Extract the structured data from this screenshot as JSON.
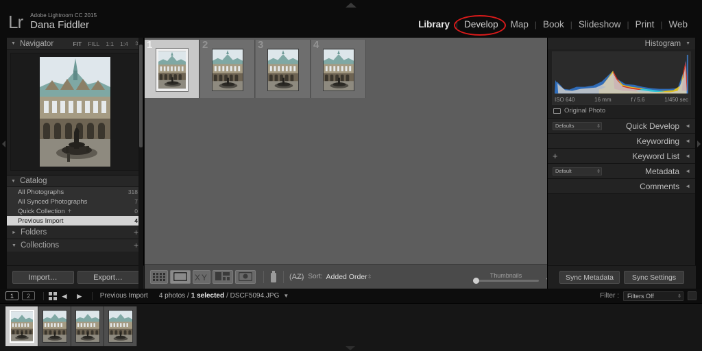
{
  "app": {
    "logo": "Lr",
    "product": "Adobe Lightroom CC 2015",
    "user": "Dana Fiddler"
  },
  "modules": {
    "items": [
      {
        "label": "Library",
        "active": true
      },
      {
        "label": "Develop",
        "active": false,
        "highlighted": true
      },
      {
        "label": "Map",
        "active": false
      },
      {
        "label": "Book",
        "active": false
      },
      {
        "label": "Slideshow",
        "active": false
      },
      {
        "label": "Print",
        "active": false
      },
      {
        "label": "Web",
        "active": false
      }
    ],
    "separator": "|",
    "highlight_color": "#d81a1a"
  },
  "left_panel": {
    "navigator": {
      "title": "Navigator",
      "twisty": "▼",
      "zoom_levels": [
        "FIT",
        "FILL",
        "1:1",
        "1:4"
      ],
      "active_zoom": "FIT"
    },
    "catalog": {
      "title": "Catalog",
      "twisty": "▼",
      "rows": [
        {
          "label": "All Photographs",
          "count": "318",
          "selected": false
        },
        {
          "label": "All Synced Photographs",
          "count": "7",
          "selected": false
        },
        {
          "label": "Quick Collection",
          "count": "0",
          "selected": false,
          "plus": "+"
        },
        {
          "label": "Previous Import",
          "count": "4",
          "selected": true
        }
      ]
    },
    "folders": {
      "title": "Folders",
      "twisty": "►",
      "add": "+"
    },
    "collections": {
      "title": "Collections",
      "twisty": "▼",
      "add": "+"
    },
    "import_button": "Import…",
    "export_button": "Export…"
  },
  "grid": {
    "cells": [
      {
        "index": "1",
        "selected": true
      },
      {
        "index": "2",
        "selected": false
      },
      {
        "index": "3",
        "selected": false
      },
      {
        "index": "4",
        "selected": false
      }
    ]
  },
  "toolbar": {
    "view_buttons": [
      {
        "name": "grid-view",
        "active": false
      },
      {
        "name": "loupe-view",
        "active": true
      },
      {
        "name": "compare-view",
        "active": false
      },
      {
        "name": "survey-view",
        "active": false
      },
      {
        "name": "people-view",
        "active": false
      }
    ],
    "painter_icon": "spray-can-icon",
    "sort_icon": "A/Z",
    "sort_label": "Sort:",
    "sort_value": "Added Order",
    "thumbnails_label": "Thumbnails",
    "thumbnails_value": 6
  },
  "right_panel": {
    "histogram": {
      "title": "Histogram",
      "caret": "▼",
      "iso": "ISO 640",
      "focal": "16 mm",
      "aperture": "f / 5.6",
      "shutter": "1/450 sec",
      "original_photo": "Original Photo"
    },
    "sections": [
      {
        "label": "Quick Develop",
        "caret": "◄",
        "select": "Defaults",
        "plus": null
      },
      {
        "label": "Keywording",
        "caret": "◄",
        "select": null,
        "plus": null
      },
      {
        "label": "Keyword List",
        "caret": "◄",
        "select": null,
        "plus": "+"
      },
      {
        "label": "Metadata",
        "caret": "◄",
        "select": "Default",
        "plus": null
      },
      {
        "label": "Comments",
        "caret": "◄",
        "select": null,
        "plus": null
      }
    ],
    "sync_metadata_button": "Sync Metadata",
    "sync_settings_button": "Sync Settings"
  },
  "filmstrip": {
    "monitor_1": "1",
    "monitor_2": "2",
    "back_arrow": "◄",
    "forward_arrow": "►",
    "source": "Previous Import",
    "photo_count": "4 photos /",
    "selected_count": "1 selected",
    "filename": "/ DSCF5094.JPG",
    "caret": "▼",
    "filter_label": "Filter :",
    "filter_value": "Filters Off",
    "thumbs": [
      {
        "selected": true
      },
      {
        "selected": false
      },
      {
        "selected": false
      },
      {
        "selected": false
      }
    ]
  }
}
